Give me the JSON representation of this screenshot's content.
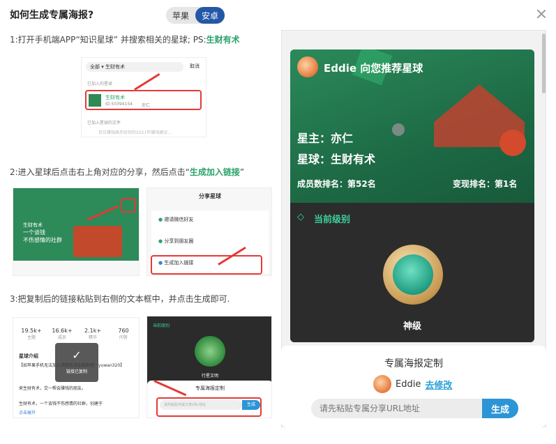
{
  "dialog": {
    "title": "如何生成专属海报?",
    "platform_tabs": [
      {
        "label": "苹果",
        "active": false
      },
      {
        "label": "安卓",
        "active": true
      }
    ]
  },
  "steps": [
    {
      "text": "1:打开手机端APP“知识星球” 并搜索相关的星球; PS:",
      "highlight": "生财有术"
    },
    {
      "text": "2:进入星球后点击右上角对应的分享，然后点击“",
      "highlight": "生成加入链接",
      "suffix": "”"
    },
    {
      "text": "3:把复制后的链接粘贴到右侧的文本框中，并点击生成即可.",
      "highlight": ""
    }
  ],
  "screenshot1": {
    "scope": "全部",
    "query": "生财有术",
    "cancel": "取消",
    "joined_label": "已加入的星球",
    "planet_name": "生财有术",
    "planet_id": "ID:50394154",
    "owner": "亦仁",
    "files_label": "已加入星球的文件",
    "file_snippet": "百位赚钱高手给你的2021年赚钱建议..."
  },
  "screenshot2": {
    "share_title": "分享星球",
    "options": [
      "邀请微信好友",
      "分享到朋友圈",
      "生成加入链接"
    ],
    "left_planet": "生财有术",
    "left_slogan": "一个谈钱\n不伤感情的社群"
  },
  "screenshot3": {
    "stats": [
      {
        "value": "19.5k+",
        "label": "主题"
      },
      {
        "value": "16.6k+",
        "label": "成员"
      },
      {
        "value": "2.1k+",
        "label": "精华"
      },
      {
        "value": "760",
        "label": "问答"
      }
    ],
    "intro_title": "星球介绍",
    "intro_text": "【如苹果手机无法加入请微信添加我助理：yuwan320】",
    "intro_more": "来生财有术，交一帮会赚钱的朋友。",
    "intro_more2": "生财有术，一个谈钱不伤感情的社群，创建于",
    "expand": "点击展开",
    "toast": "链接已复制",
    "level_label": "当前级别",
    "level_name": "行星文明",
    "custom_title": "专属海报定制",
    "input_placeholder": "请先粘贴专属分享URL地址",
    "gen": "生成"
  },
  "poster": {
    "header": "Eddie 向您推荐星球",
    "owner_line": "星主：亦仁",
    "planet_line": "星球：生财有术",
    "member_rank": "成员数排名：第52名",
    "monetize_rank": "变现排名：第1名",
    "level_label": "当前级别",
    "level_name": "神级"
  },
  "custom": {
    "title": "专属海报定制",
    "user_name": "Eddie",
    "edit_label": "去修改",
    "url_placeholder": "请先粘贴专属分享URL地址",
    "generate_label": "生成"
  },
  "colors": {
    "accent": "#2457a6",
    "highlight_green": "#2aa26a",
    "button_blue": "#2c95d6",
    "poster_green": "#1f6b47"
  }
}
